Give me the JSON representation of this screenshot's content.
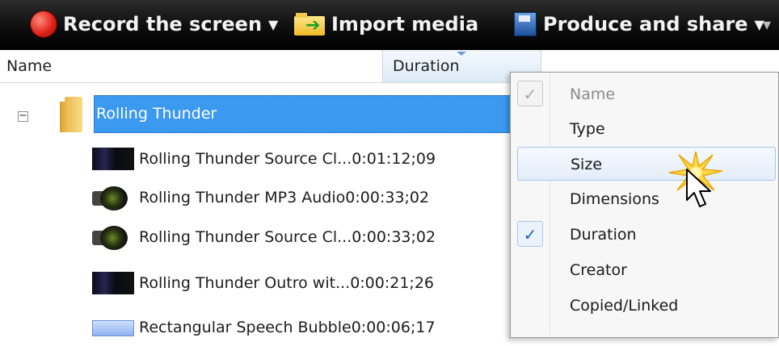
{
  "toolbar": {
    "record_label": "Record the screen",
    "import_label": "Import media",
    "produce_label": "Produce and share",
    "icons": {
      "record": "record-dot-icon",
      "import": "folder-import-icon",
      "produce": "disk-icon"
    }
  },
  "columns": {
    "name": "Name",
    "duration": "Duration"
  },
  "tree": {
    "folder_name": "Rolling Thunder",
    "items": [
      {
        "name": "Rolling Thunder Source Cl...",
        "duration": "0:01:12;09",
        "icon": "video-thumbnail-icon"
      },
      {
        "name": "Rolling Thunder MP3 Audio",
        "duration": "0:00:33;02",
        "icon": "speaker-icon"
      },
      {
        "name": "Rolling Thunder Source Cl...",
        "duration": "0:00:33;02",
        "icon": "speaker-icon"
      },
      {
        "name": "Rolling Thunder Outro wit...",
        "duration": "0:00:21;26",
        "icon": "video-thumbnail-icon"
      },
      {
        "name": "Rectangular Speech Bubble",
        "duration": "0:00:06;17",
        "icon": "callout-icon"
      }
    ]
  },
  "context_menu": {
    "items": [
      {
        "label": "Name",
        "checked": true,
        "disabled": true
      },
      {
        "label": "Type",
        "checked": false
      },
      {
        "label": "Size",
        "checked": false,
        "hover": true
      },
      {
        "label": "Dimensions",
        "checked": false
      },
      {
        "label": "Duration",
        "checked": true
      },
      {
        "label": "Creator",
        "checked": false
      },
      {
        "label": "Copied/Linked",
        "checked": false
      }
    ]
  },
  "colors": {
    "selection": "#3c99f0",
    "toolbar": "#111111",
    "check": "#1f5fbf"
  }
}
